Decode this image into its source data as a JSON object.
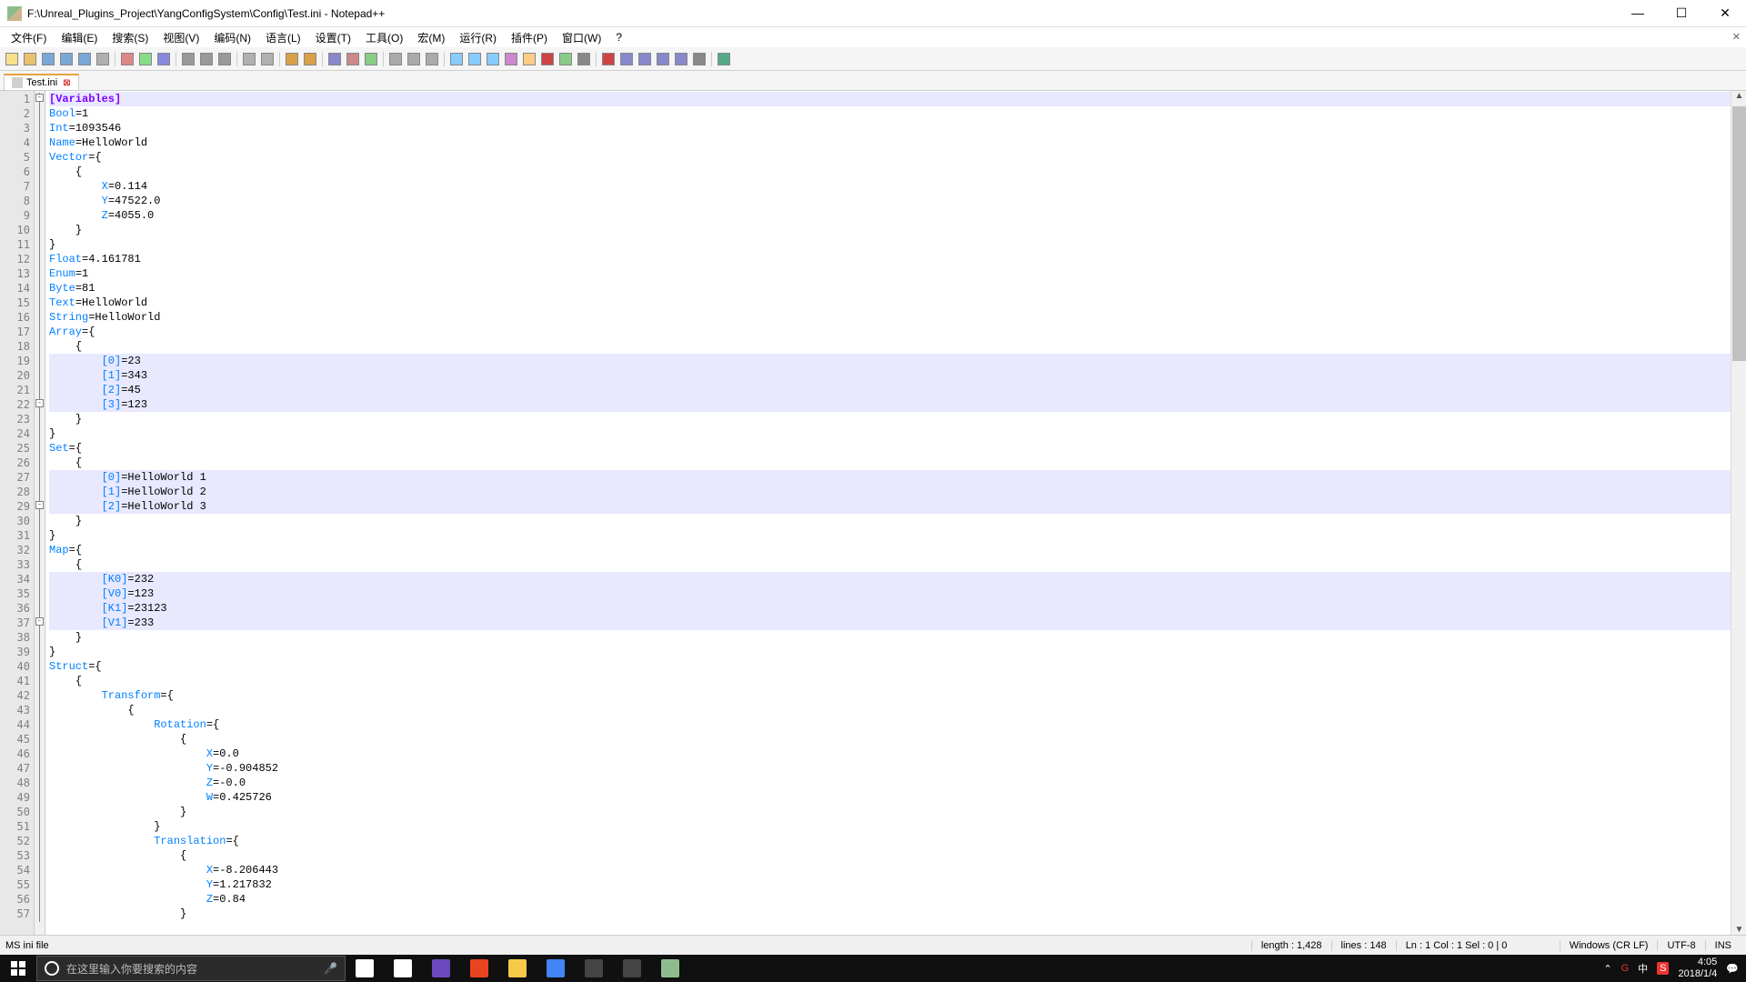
{
  "window": {
    "title": "F:\\Unreal_Plugins_Project\\YangConfigSystem\\Config\\Test.ini - Notepad++"
  },
  "menus": [
    "文件(F)",
    "编辑(E)",
    "搜索(S)",
    "视图(V)",
    "编码(N)",
    "语言(L)",
    "设置(T)",
    "工具(O)",
    "宏(M)",
    "运行(R)",
    "插件(P)",
    "窗口(W)",
    "?"
  ],
  "tab": {
    "name": "Test.ini"
  },
  "code": [
    {
      "n": 1,
      "hl": true,
      "indent": 0,
      "seg": [
        {
          "c": "section",
          "t": "[Variables]"
        }
      ]
    },
    {
      "n": 2,
      "indent": 0,
      "seg": [
        {
          "c": "key",
          "t": "Bool"
        },
        {
          "c": "eq",
          "t": "="
        },
        {
          "c": "val",
          "t": "1"
        }
      ]
    },
    {
      "n": 3,
      "indent": 0,
      "seg": [
        {
          "c": "key",
          "t": "Int"
        },
        {
          "c": "eq",
          "t": "="
        },
        {
          "c": "val",
          "t": "1093546"
        }
      ]
    },
    {
      "n": 4,
      "indent": 0,
      "seg": [
        {
          "c": "key",
          "t": "Name"
        },
        {
          "c": "eq",
          "t": "="
        },
        {
          "c": "val",
          "t": "HelloWorld"
        }
      ]
    },
    {
      "n": 5,
      "indent": 0,
      "seg": [
        {
          "c": "key",
          "t": "Vector"
        },
        {
          "c": "eq",
          "t": "="
        },
        {
          "c": "val",
          "t": "{"
        }
      ]
    },
    {
      "n": 6,
      "indent": 1,
      "seg": [
        {
          "c": "val",
          "t": "{"
        }
      ]
    },
    {
      "n": 7,
      "indent": 2,
      "seg": [
        {
          "c": "key",
          "t": "X"
        },
        {
          "c": "eq",
          "t": "="
        },
        {
          "c": "val",
          "t": "0.114"
        }
      ]
    },
    {
      "n": 8,
      "indent": 2,
      "seg": [
        {
          "c": "key",
          "t": "Y"
        },
        {
          "c": "eq",
          "t": "="
        },
        {
          "c": "val",
          "t": "47522.0"
        }
      ]
    },
    {
      "n": 9,
      "indent": 2,
      "seg": [
        {
          "c": "key",
          "t": "Z"
        },
        {
          "c": "eq",
          "t": "="
        },
        {
          "c": "val",
          "t": "4055.0"
        }
      ]
    },
    {
      "n": 10,
      "indent": 1,
      "seg": [
        {
          "c": "val",
          "t": "}"
        }
      ]
    },
    {
      "n": 11,
      "indent": 0,
      "seg": [
        {
          "c": "val",
          "t": "}"
        }
      ]
    },
    {
      "n": 12,
      "indent": 0,
      "seg": [
        {
          "c": "key",
          "t": "Float"
        },
        {
          "c": "eq",
          "t": "="
        },
        {
          "c": "val",
          "t": "4.161781"
        }
      ]
    },
    {
      "n": 13,
      "indent": 0,
      "seg": [
        {
          "c": "key",
          "t": "Enum"
        },
        {
          "c": "eq",
          "t": "="
        },
        {
          "c": "val",
          "t": "1"
        }
      ]
    },
    {
      "n": 14,
      "indent": 0,
      "seg": [
        {
          "c": "key",
          "t": "Byte"
        },
        {
          "c": "eq",
          "t": "="
        },
        {
          "c": "val",
          "t": "81"
        }
      ]
    },
    {
      "n": 15,
      "indent": 0,
      "seg": [
        {
          "c": "key",
          "t": "Text"
        },
        {
          "c": "eq",
          "t": "="
        },
        {
          "c": "val",
          "t": "HelloWorld"
        }
      ]
    },
    {
      "n": 16,
      "indent": 0,
      "seg": [
        {
          "c": "key",
          "t": "String"
        },
        {
          "c": "eq",
          "t": "="
        },
        {
          "c": "val",
          "t": "HelloWorld"
        }
      ]
    },
    {
      "n": 17,
      "indent": 0,
      "seg": [
        {
          "c": "key",
          "t": "Array"
        },
        {
          "c": "eq",
          "t": "="
        },
        {
          "c": "val",
          "t": "{"
        }
      ]
    },
    {
      "n": 18,
      "indent": 1,
      "seg": [
        {
          "c": "val",
          "t": "{"
        }
      ]
    },
    {
      "n": 19,
      "hl": true,
      "indent": 2,
      "seg": [
        {
          "c": "key",
          "t": "[0]"
        },
        {
          "c": "eq",
          "t": "="
        },
        {
          "c": "val",
          "t": "23"
        }
      ]
    },
    {
      "n": 20,
      "hl": true,
      "indent": 2,
      "seg": [
        {
          "c": "key",
          "t": "[1]"
        },
        {
          "c": "eq",
          "t": "="
        },
        {
          "c": "val",
          "t": "343"
        }
      ]
    },
    {
      "n": 21,
      "hl": true,
      "indent": 2,
      "seg": [
        {
          "c": "key",
          "t": "[2]"
        },
        {
          "c": "eq",
          "t": "="
        },
        {
          "c": "val",
          "t": "45"
        }
      ]
    },
    {
      "n": 22,
      "hl": true,
      "indent": 2,
      "seg": [
        {
          "c": "key",
          "t": "[3]"
        },
        {
          "c": "eq",
          "t": "="
        },
        {
          "c": "val",
          "t": "123"
        }
      ]
    },
    {
      "n": 23,
      "indent": 1,
      "seg": [
        {
          "c": "val",
          "t": "}"
        }
      ]
    },
    {
      "n": 24,
      "indent": 0,
      "seg": [
        {
          "c": "val",
          "t": "}"
        }
      ]
    },
    {
      "n": 25,
      "indent": 0,
      "seg": [
        {
          "c": "key",
          "t": "Set"
        },
        {
          "c": "eq",
          "t": "="
        },
        {
          "c": "val",
          "t": "{"
        }
      ]
    },
    {
      "n": 26,
      "indent": 1,
      "seg": [
        {
          "c": "val",
          "t": "{"
        }
      ]
    },
    {
      "n": 27,
      "hl": true,
      "indent": 2,
      "seg": [
        {
          "c": "key",
          "t": "[0]"
        },
        {
          "c": "eq",
          "t": "="
        },
        {
          "c": "val",
          "t": "HelloWorld 1"
        }
      ]
    },
    {
      "n": 28,
      "hl": true,
      "indent": 2,
      "seg": [
        {
          "c": "key",
          "t": "[1]"
        },
        {
          "c": "eq",
          "t": "="
        },
        {
          "c": "val",
          "t": "HelloWorld 2"
        }
      ]
    },
    {
      "n": 29,
      "hl": true,
      "indent": 2,
      "seg": [
        {
          "c": "key",
          "t": "[2]"
        },
        {
          "c": "eq",
          "t": "="
        },
        {
          "c": "val",
          "t": "HelloWorld 3"
        }
      ]
    },
    {
      "n": 30,
      "indent": 1,
      "seg": [
        {
          "c": "val",
          "t": "}"
        }
      ]
    },
    {
      "n": 31,
      "indent": 0,
      "seg": [
        {
          "c": "val",
          "t": "}"
        }
      ]
    },
    {
      "n": 32,
      "indent": 0,
      "seg": [
        {
          "c": "key",
          "t": "Map"
        },
        {
          "c": "eq",
          "t": "="
        },
        {
          "c": "val",
          "t": "{"
        }
      ]
    },
    {
      "n": 33,
      "indent": 1,
      "seg": [
        {
          "c": "val",
          "t": "{"
        }
      ]
    },
    {
      "n": 34,
      "hl": true,
      "indent": 2,
      "seg": [
        {
          "c": "key",
          "t": "[K0]"
        },
        {
          "c": "eq",
          "t": "="
        },
        {
          "c": "val",
          "t": "232"
        }
      ]
    },
    {
      "n": 35,
      "hl": true,
      "indent": 2,
      "seg": [
        {
          "c": "key",
          "t": "[V0]"
        },
        {
          "c": "eq",
          "t": "="
        },
        {
          "c": "val",
          "t": "123"
        }
      ]
    },
    {
      "n": 36,
      "hl": true,
      "indent": 2,
      "seg": [
        {
          "c": "key",
          "t": "[K1]"
        },
        {
          "c": "eq",
          "t": "="
        },
        {
          "c": "val",
          "t": "23123"
        }
      ]
    },
    {
      "n": 37,
      "hl": true,
      "indent": 2,
      "seg": [
        {
          "c": "key",
          "t": "[V1]"
        },
        {
          "c": "eq",
          "t": "="
        },
        {
          "c": "val",
          "t": "233"
        }
      ]
    },
    {
      "n": 38,
      "indent": 1,
      "seg": [
        {
          "c": "val",
          "t": "}"
        }
      ]
    },
    {
      "n": 39,
      "indent": 0,
      "seg": [
        {
          "c": "val",
          "t": "}"
        }
      ]
    },
    {
      "n": 40,
      "indent": 0,
      "seg": [
        {
          "c": "key",
          "t": "Struct"
        },
        {
          "c": "eq",
          "t": "="
        },
        {
          "c": "val",
          "t": "{"
        }
      ]
    },
    {
      "n": 41,
      "indent": 1,
      "seg": [
        {
          "c": "val",
          "t": "{"
        }
      ]
    },
    {
      "n": 42,
      "indent": 2,
      "seg": [
        {
          "c": "key",
          "t": "Transform"
        },
        {
          "c": "eq",
          "t": "="
        },
        {
          "c": "val",
          "t": "{"
        }
      ]
    },
    {
      "n": 43,
      "indent": 3,
      "seg": [
        {
          "c": "val",
          "t": "{"
        }
      ]
    },
    {
      "n": 44,
      "indent": 4,
      "seg": [
        {
          "c": "key",
          "t": "Rotation"
        },
        {
          "c": "eq",
          "t": "="
        },
        {
          "c": "val",
          "t": "{"
        }
      ]
    },
    {
      "n": 45,
      "indent": 5,
      "seg": [
        {
          "c": "val",
          "t": "{"
        }
      ]
    },
    {
      "n": 46,
      "indent": 6,
      "seg": [
        {
          "c": "key",
          "t": "X"
        },
        {
          "c": "eq",
          "t": "="
        },
        {
          "c": "val",
          "t": "0.0"
        }
      ]
    },
    {
      "n": 47,
      "indent": 6,
      "seg": [
        {
          "c": "key",
          "t": "Y"
        },
        {
          "c": "eq",
          "t": "="
        },
        {
          "c": "val",
          "t": "-0.904852"
        }
      ]
    },
    {
      "n": 48,
      "indent": 6,
      "seg": [
        {
          "c": "key",
          "t": "Z"
        },
        {
          "c": "eq",
          "t": "="
        },
        {
          "c": "val",
          "t": "-0.0"
        }
      ]
    },
    {
      "n": 49,
      "indent": 6,
      "seg": [
        {
          "c": "key",
          "t": "W"
        },
        {
          "c": "eq",
          "t": "="
        },
        {
          "c": "val",
          "t": "0.425726"
        }
      ]
    },
    {
      "n": 50,
      "indent": 5,
      "seg": [
        {
          "c": "val",
          "t": "}"
        }
      ]
    },
    {
      "n": 51,
      "indent": 4,
      "seg": [
        {
          "c": "val",
          "t": "}"
        }
      ]
    },
    {
      "n": 52,
      "indent": 4,
      "seg": [
        {
          "c": "key",
          "t": "Translation"
        },
        {
          "c": "eq",
          "t": "="
        },
        {
          "c": "val",
          "t": "{"
        }
      ]
    },
    {
      "n": 53,
      "indent": 5,
      "seg": [
        {
          "c": "val",
          "t": "{"
        }
      ]
    },
    {
      "n": 54,
      "indent": 6,
      "seg": [
        {
          "c": "key",
          "t": "X"
        },
        {
          "c": "eq",
          "t": "="
        },
        {
          "c": "val",
          "t": "-8.206443"
        }
      ]
    },
    {
      "n": 55,
      "indent": 6,
      "seg": [
        {
          "c": "key",
          "t": "Y"
        },
        {
          "c": "eq",
          "t": "="
        },
        {
          "c": "val",
          "t": "1.217832"
        }
      ]
    },
    {
      "n": 56,
      "indent": 6,
      "seg": [
        {
          "c": "key",
          "t": "Z"
        },
        {
          "c": "eq",
          "t": "="
        },
        {
          "c": "val",
          "t": "0.84"
        }
      ]
    },
    {
      "n": 57,
      "indent": 5,
      "seg": [
        {
          "c": "val",
          "t": "}"
        }
      ]
    }
  ],
  "fold_boxes": [
    1,
    22,
    29,
    37
  ],
  "status": {
    "filetype": "MS ini file",
    "length": "length : 1,428",
    "lines": "lines : 148",
    "pos": "Ln : 1    Col : 1    Sel : 0 | 0",
    "eol": "Windows (CR LF)",
    "enc": "UTF-8",
    "mode": "INS"
  },
  "taskbar": {
    "search_placeholder": "在这里输入你要搜索的内容",
    "time": "4:05",
    "date": "2018/1/4",
    "tray_icons": [
      "G",
      "中",
      "S"
    ]
  }
}
